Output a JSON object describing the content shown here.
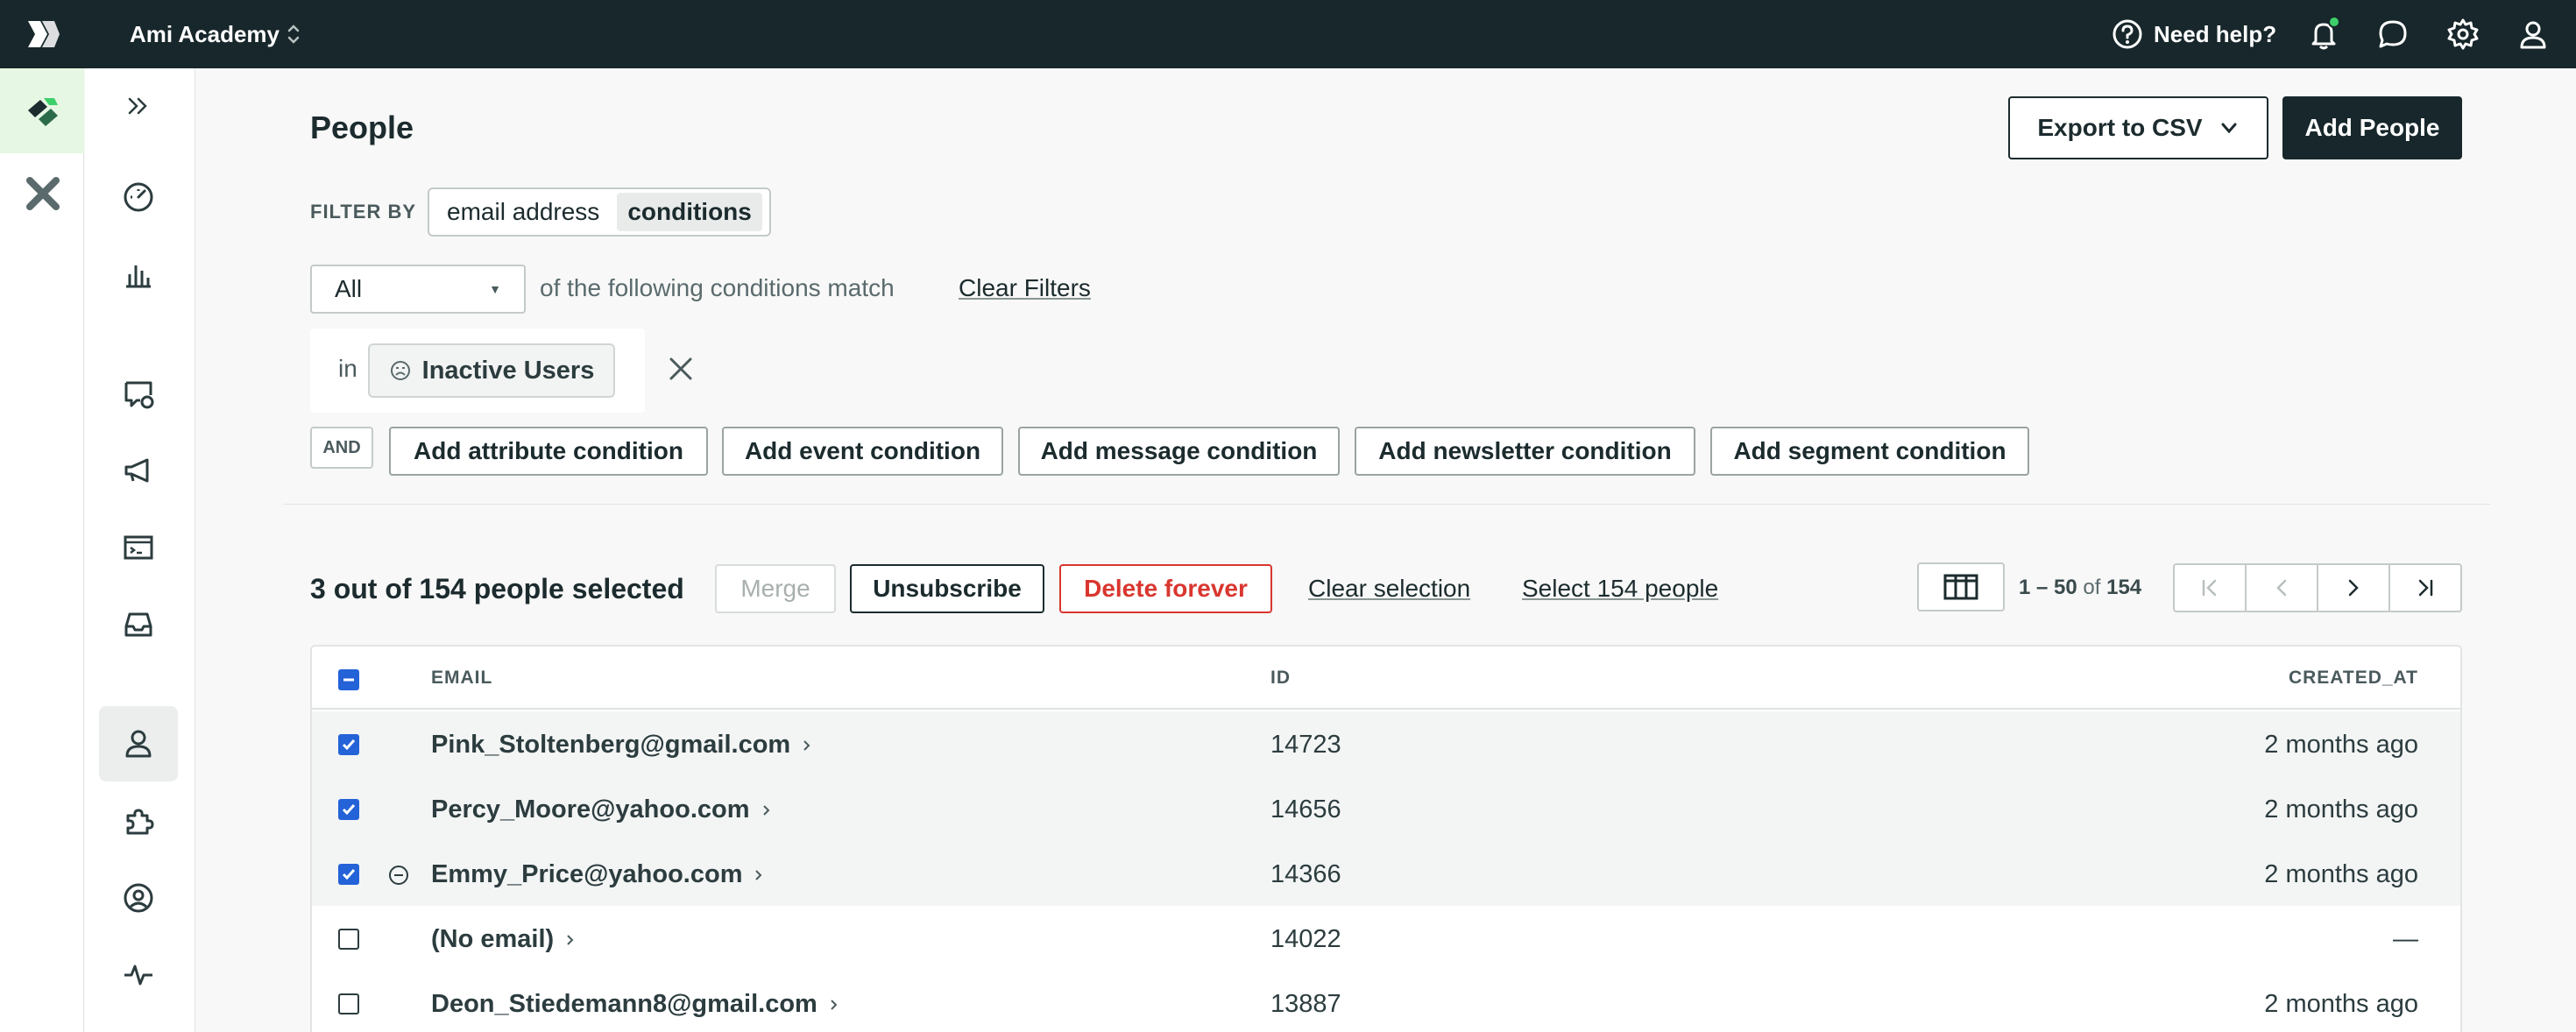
{
  "topbar": {
    "workspace": "Ami Academy",
    "help_label": "Need help?",
    "icons": [
      "bell-icon",
      "chat-icon",
      "gear-icon",
      "user-icon"
    ]
  },
  "page": {
    "title": "People",
    "export_label": "Export to CSV",
    "add_label": "Add People"
  },
  "filter": {
    "label": "FILTER BY",
    "options": [
      "email address",
      "conditions"
    ],
    "active_option": "conditions",
    "match_select": "All",
    "match_text": "of the following conditions match",
    "clear_label": "Clear Filters",
    "condition": {
      "prefix": "in",
      "segment": "Inactive Users"
    },
    "and_label": "AND",
    "add_buttons": [
      "Add attribute condition",
      "Add event condition",
      "Add message condition",
      "Add newsletter condition",
      "Add segment condition"
    ]
  },
  "selection": {
    "count_text": "3 out of 154 people selected",
    "merge_label": "Merge",
    "unsubscribe_label": "Unsubscribe",
    "delete_label": "Delete forever",
    "clear_label": "Clear selection",
    "select_all_label": "Select 154 people"
  },
  "pagination": {
    "range": "1 – 50",
    "of": "of",
    "total": "154"
  },
  "table": {
    "columns": [
      "EMAIL",
      "ID",
      "CREATED_AT"
    ],
    "rows": [
      {
        "email": "Pink_Stoltenberg@gmail.com",
        "id": "14723",
        "created": "2 months ago",
        "checked": true
      },
      {
        "email": "Percy_Moore@yahoo.com",
        "id": "14656",
        "created": "2 months ago",
        "checked": true
      },
      {
        "email": "Emmy_Price@yahoo.com",
        "id": "14366",
        "created": "2 months ago",
        "checked": true
      },
      {
        "email": "(No email)",
        "id": "14022",
        "created": "—",
        "checked": false
      },
      {
        "email": "Deon_Stiedemann8@gmail.com",
        "id": "13887",
        "created": "2 months ago",
        "checked": false
      }
    ]
  },
  "colors": {
    "topbar": "#17272b",
    "accent_green": "#3ecf6a",
    "checkbox_blue": "#2462d8",
    "danger": "#d9362f"
  }
}
